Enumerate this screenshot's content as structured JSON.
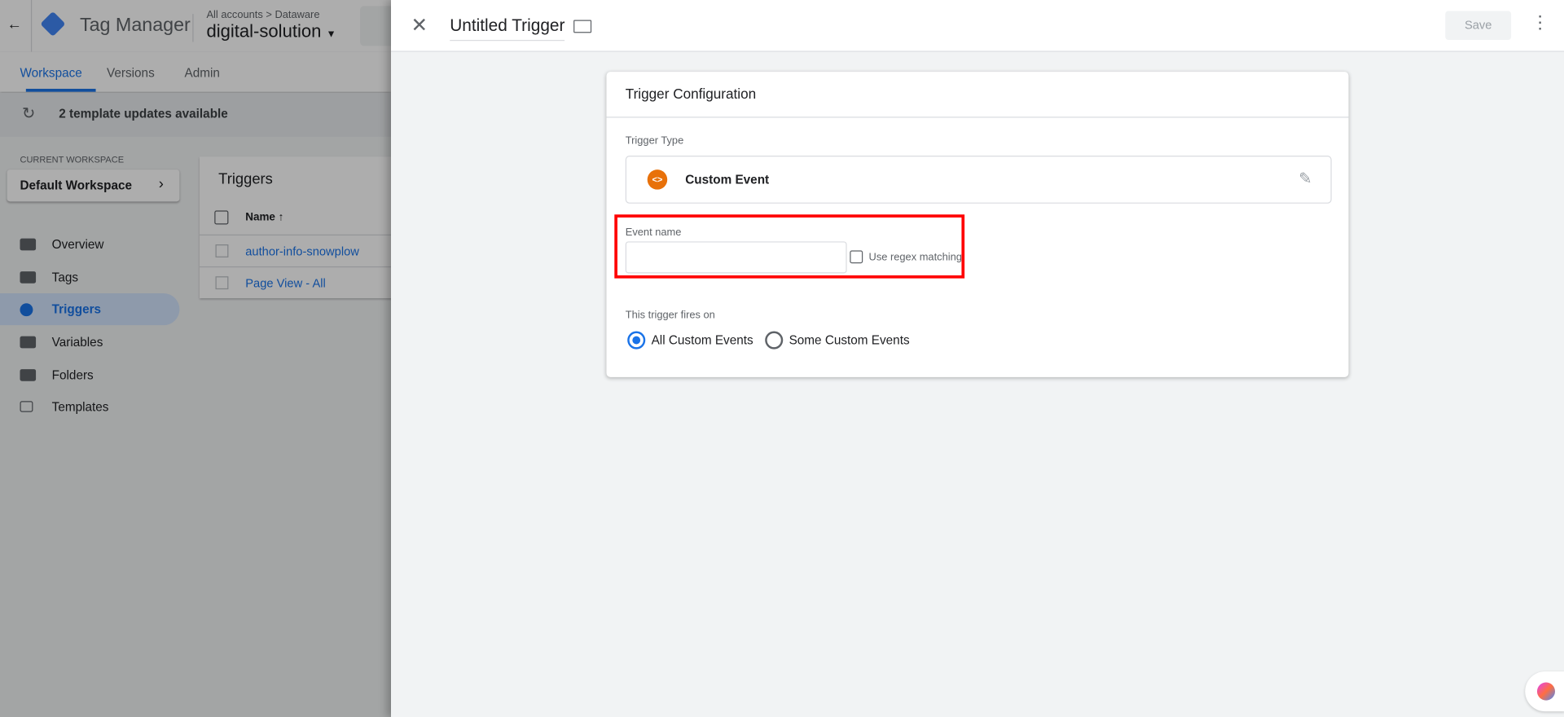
{
  "app": {
    "name": "Tag Manager",
    "breadcrumb": "All accounts > Dataware",
    "container": "digital-solution"
  },
  "tabs": [
    {
      "label": "Workspace",
      "active": true
    },
    {
      "label": "Versions"
    },
    {
      "label": "Admin"
    }
  ],
  "updates": {
    "text": "2 template updates available"
  },
  "workspace": {
    "caption": "CURRENT WORKSPACE",
    "name": "Default Workspace"
  },
  "nav": [
    {
      "label": "Overview",
      "icon": "overview-icon"
    },
    {
      "label": "Tags",
      "icon": "tag-icon"
    },
    {
      "label": "Triggers",
      "icon": "trigger-icon",
      "active": true
    },
    {
      "label": "Variables",
      "icon": "variables-icon"
    },
    {
      "label": "Folders",
      "icon": "folder-icon"
    },
    {
      "label": "Templates",
      "icon": "template-icon"
    }
  ],
  "triggers_list": {
    "title": "Triggers",
    "column": "Name",
    "rows": [
      "author-info-snowplow",
      "Page View - All"
    ]
  },
  "panel": {
    "title": "Untitled Trigger",
    "save_label": "Save"
  },
  "config": {
    "title": "Trigger Configuration",
    "type_label": "Trigger Type",
    "type_value": "Custom Event",
    "event_name_label": "Event name",
    "event_name_value": "",
    "regex_label": "Use regex matching",
    "regex_checked": false,
    "fires_on_label": "This trigger fires on",
    "options": [
      {
        "label": "All Custom Events",
        "selected": true
      },
      {
        "label": "Some Custom Events",
        "selected": false
      }
    ]
  },
  "colors": {
    "accent": "#1a73e8",
    "custom_event": "#e8710a",
    "highlight": "#ff0000"
  }
}
